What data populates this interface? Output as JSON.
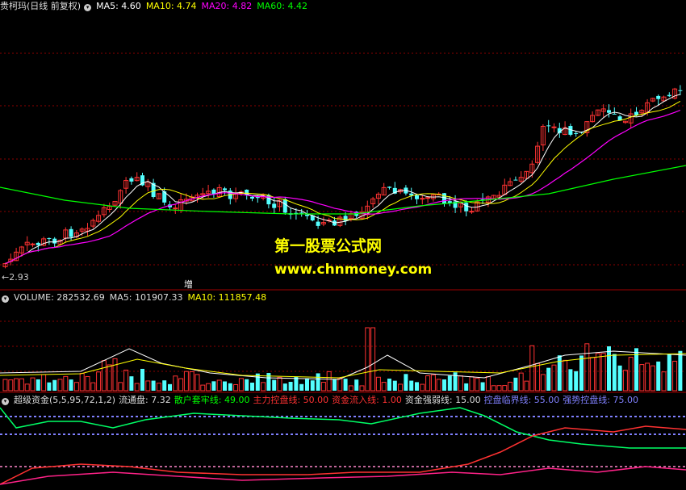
{
  "main_header": {
    "stock": "贵柯玛(日线 前复权)",
    "ma5": "MA5: 4.60",
    "ma10": "MA10: 4.74",
    "ma20": "MA20: 4.82",
    "ma60": "MA60: 4.42"
  },
  "main_panel": {
    "low_price_label": "2.93",
    "marker_label": "增"
  },
  "watermark": {
    "line1": "第一股票公式网",
    "line2": "www.chnmoney.com"
  },
  "volume_header": {
    "volume": "VOLUME: 282532.69",
    "ma5": "MA5: 101907.33",
    "ma10": "MA10: 111857.48"
  },
  "indicator_header": {
    "name": "超级资金(5,5,95,72,1,2)",
    "float": "流通盘: 7.32",
    "retail": "散户套牢线: 49.00",
    "main": "主力控盘线: 50.00",
    "inflow": "资金流入线: 1.00",
    "strength": "资金强弱线: 15.00",
    "critical": "控盘临界线: 55.00",
    "strong": "强势控盘线: 75.00"
  },
  "colors": {
    "up": "#ff3232",
    "down": "#54ffff",
    "ma5": "#ffffff",
    "ma10": "#ffff00",
    "ma20": "#ff00ff",
    "ma60": "#00ff00",
    "separator": "#a00000",
    "grid": "#8b0000"
  }
}
